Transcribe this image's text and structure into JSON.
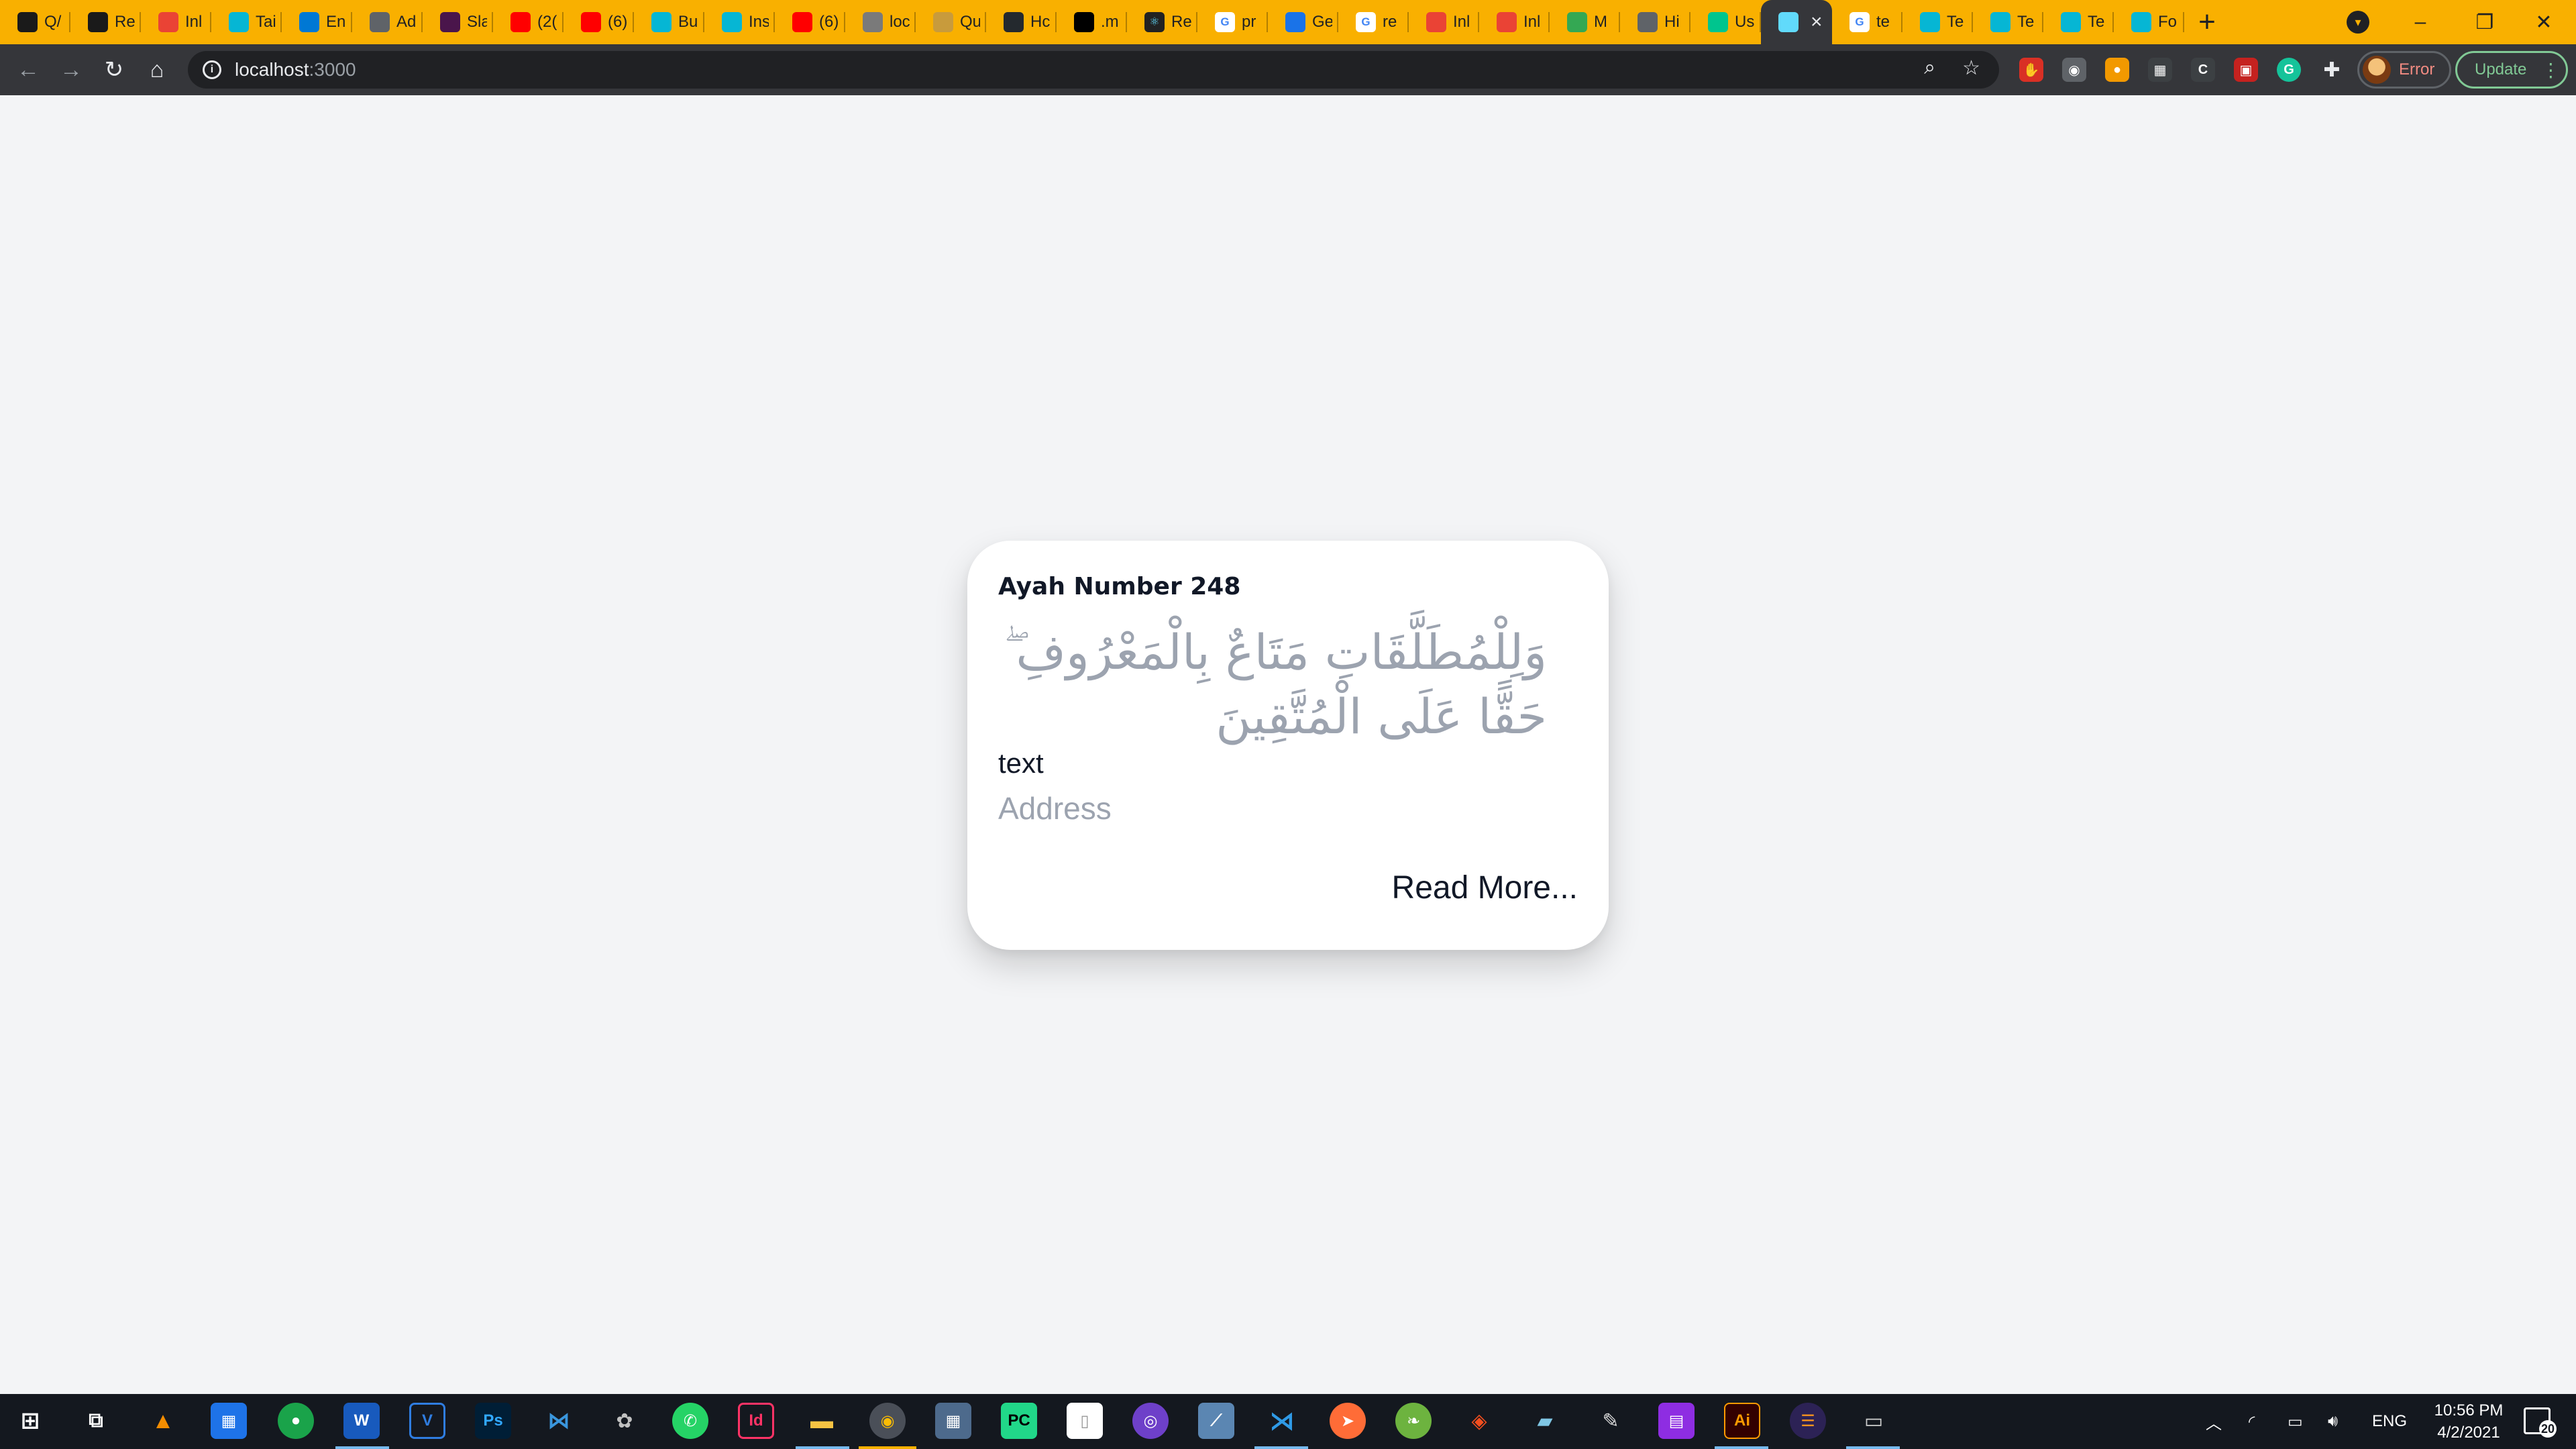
{
  "browser": {
    "tabs": [
      {
        "icon": "answer-site-icon",
        "label": "Q/",
        "color": "#1a1a1a"
      },
      {
        "icon": "answer-site-icon",
        "label": "Re",
        "color": "#1a1a1a"
      },
      {
        "icon": "gmail-icon",
        "label": "Inl",
        "color": "#ea4335"
      },
      {
        "icon": "tailwind-icon",
        "label": "Tai",
        "color": "#06b6d4"
      },
      {
        "icon": "outlook-icon",
        "label": "En",
        "color": "#0078d4"
      },
      {
        "icon": "ad-icon",
        "label": "Ad",
        "color": "#5f6368"
      },
      {
        "icon": "slack-icon",
        "label": "Sla",
        "color": "#4a154b"
      },
      {
        "icon": "youtube-icon",
        "label": "(2(",
        "color": "#ff0000"
      },
      {
        "icon": "youtube-icon",
        "label": "(6)",
        "color": "#ff0000"
      },
      {
        "icon": "tailwind-icon",
        "label": "Bu",
        "color": "#06b6d4"
      },
      {
        "icon": "tailwind-icon",
        "label": "Ins",
        "color": "#06b6d4"
      },
      {
        "icon": "youtube-icon",
        "label": "(6)",
        "color": "#ff0000"
      },
      {
        "icon": "globe-icon",
        "label": "loc",
        "color": "#7a7a7a"
      },
      {
        "icon": "globe-icon",
        "label": "Qu",
        "color": "#c89b3c"
      },
      {
        "icon": "github-icon",
        "label": "Hc",
        "color": "#24292e"
      },
      {
        "icon": "medium-icon",
        "label": ".m",
        "color": "#000000"
      },
      {
        "icon": "react-icon",
        "label": "Re",
        "color": "#222222"
      },
      {
        "icon": "google-icon",
        "label": "pr",
        "color": "#ffffff"
      },
      {
        "icon": "play-icon",
        "label": "Ge",
        "color": "#1a73e8"
      },
      {
        "icon": "google-icon",
        "label": "re",
        "color": "#ffffff"
      },
      {
        "icon": "gmail-icon",
        "label": "Inl",
        "color": "#ea4335"
      },
      {
        "icon": "gmail-icon",
        "label": "Inl",
        "color": "#ea4335"
      },
      {
        "icon": "drive-icon",
        "label": "M",
        "color": "#34a853"
      },
      {
        "icon": "history-icon",
        "label": "Hi",
        "color": "#5f6368"
      },
      {
        "icon": "leaf-icon",
        "label": "Us",
        "color": "#00c58e"
      },
      {
        "icon": "react-icon",
        "label": "",
        "color": "#61dafb"
      },
      {
        "icon": "google-icon",
        "label": "te",
        "color": "#ffffff"
      },
      {
        "icon": "tailwind-icon",
        "label": "Te",
        "color": "#06b6d4"
      },
      {
        "icon": "tailwind-icon",
        "label": "Te",
        "color": "#06b6d4"
      },
      {
        "icon": "tailwind-icon",
        "label": "Te",
        "color": "#06b6d4"
      },
      {
        "icon": "tailwind-icon",
        "label": "Fo",
        "color": "#06b6d4"
      }
    ],
    "active_tab_index": 25,
    "url_host": "localhost",
    "url_port": ":3000",
    "profile_label": "Error",
    "update_label": "Update"
  },
  "card": {
    "title": "Ayah Number 248",
    "ayah_text": "وَلِلْمُطَلَّقَاتِ مَتَاعٌ بِالْمَعْرُوفِ ۖ حَقًّا عَلَى الْمُتَّقِينَ",
    "text_label": "text",
    "address_label": "Address",
    "read_more_label": "Read More..."
  },
  "taskbar": {
    "keyboard_lang": "ENG",
    "time": "10:56 PM",
    "date": "4/2/2021",
    "notification_count": "20"
  },
  "colors": {
    "tab_strip": "#f9b000",
    "toolbar": "#35363a",
    "page_bg": "#f3f4f6",
    "card_bg": "#ffffff",
    "muted_text": "#9ca3af",
    "taskbar": "#14181f"
  }
}
